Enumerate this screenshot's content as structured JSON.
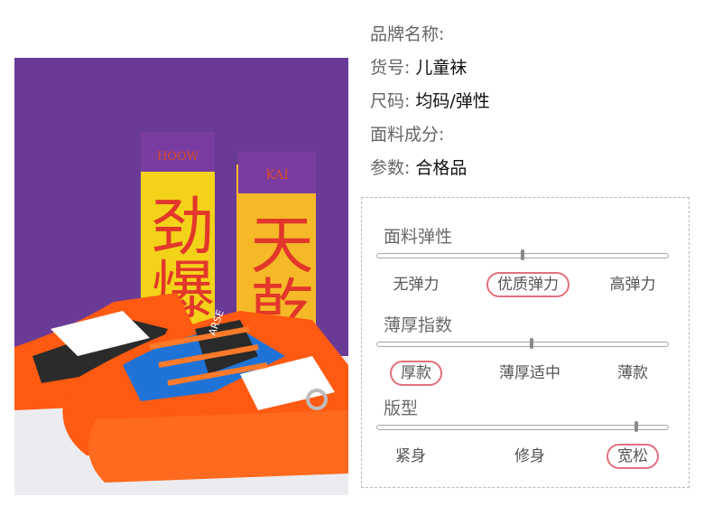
{
  "photo": {
    "sock_left_text": "HOOW",
    "sock_right_text": "KAI",
    "sock_left_chars": "劲爆",
    "sock_right_chars": "天乾",
    "shoe_text": "ARSE"
  },
  "info": [
    {
      "label": "品牌名称:",
      "value": ""
    },
    {
      "label": "货号:",
      "value": "儿童袜"
    },
    {
      "label": "尺码:",
      "value": "均码/弹性"
    },
    {
      "label": "面料成分:",
      "value": ""
    },
    {
      "label": "参数:",
      "value": "合格品"
    }
  ],
  "attributes": [
    {
      "title": "面料弹性",
      "options": [
        "无弹力",
        "优质弹力",
        "高弹力"
      ],
      "selected": 1,
      "level": 0.5
    },
    {
      "title": "薄厚指数",
      "options": [
        "厚款",
        "薄厚适中",
        "薄款"
      ],
      "selected": 0,
      "level": 0.53
    },
    {
      "title": "版型",
      "options": [
        "紧身",
        "修身",
        "宽松"
      ],
      "selected": 2,
      "level": 0.89
    }
  ],
  "colors": {
    "highlight": "#e2707c",
    "background_purple": "#6a3b96",
    "sock_yellow": "#f3d21a",
    "shoe_orange": "#ff5a12",
    "shoe_blue": "#1f73d6"
  }
}
